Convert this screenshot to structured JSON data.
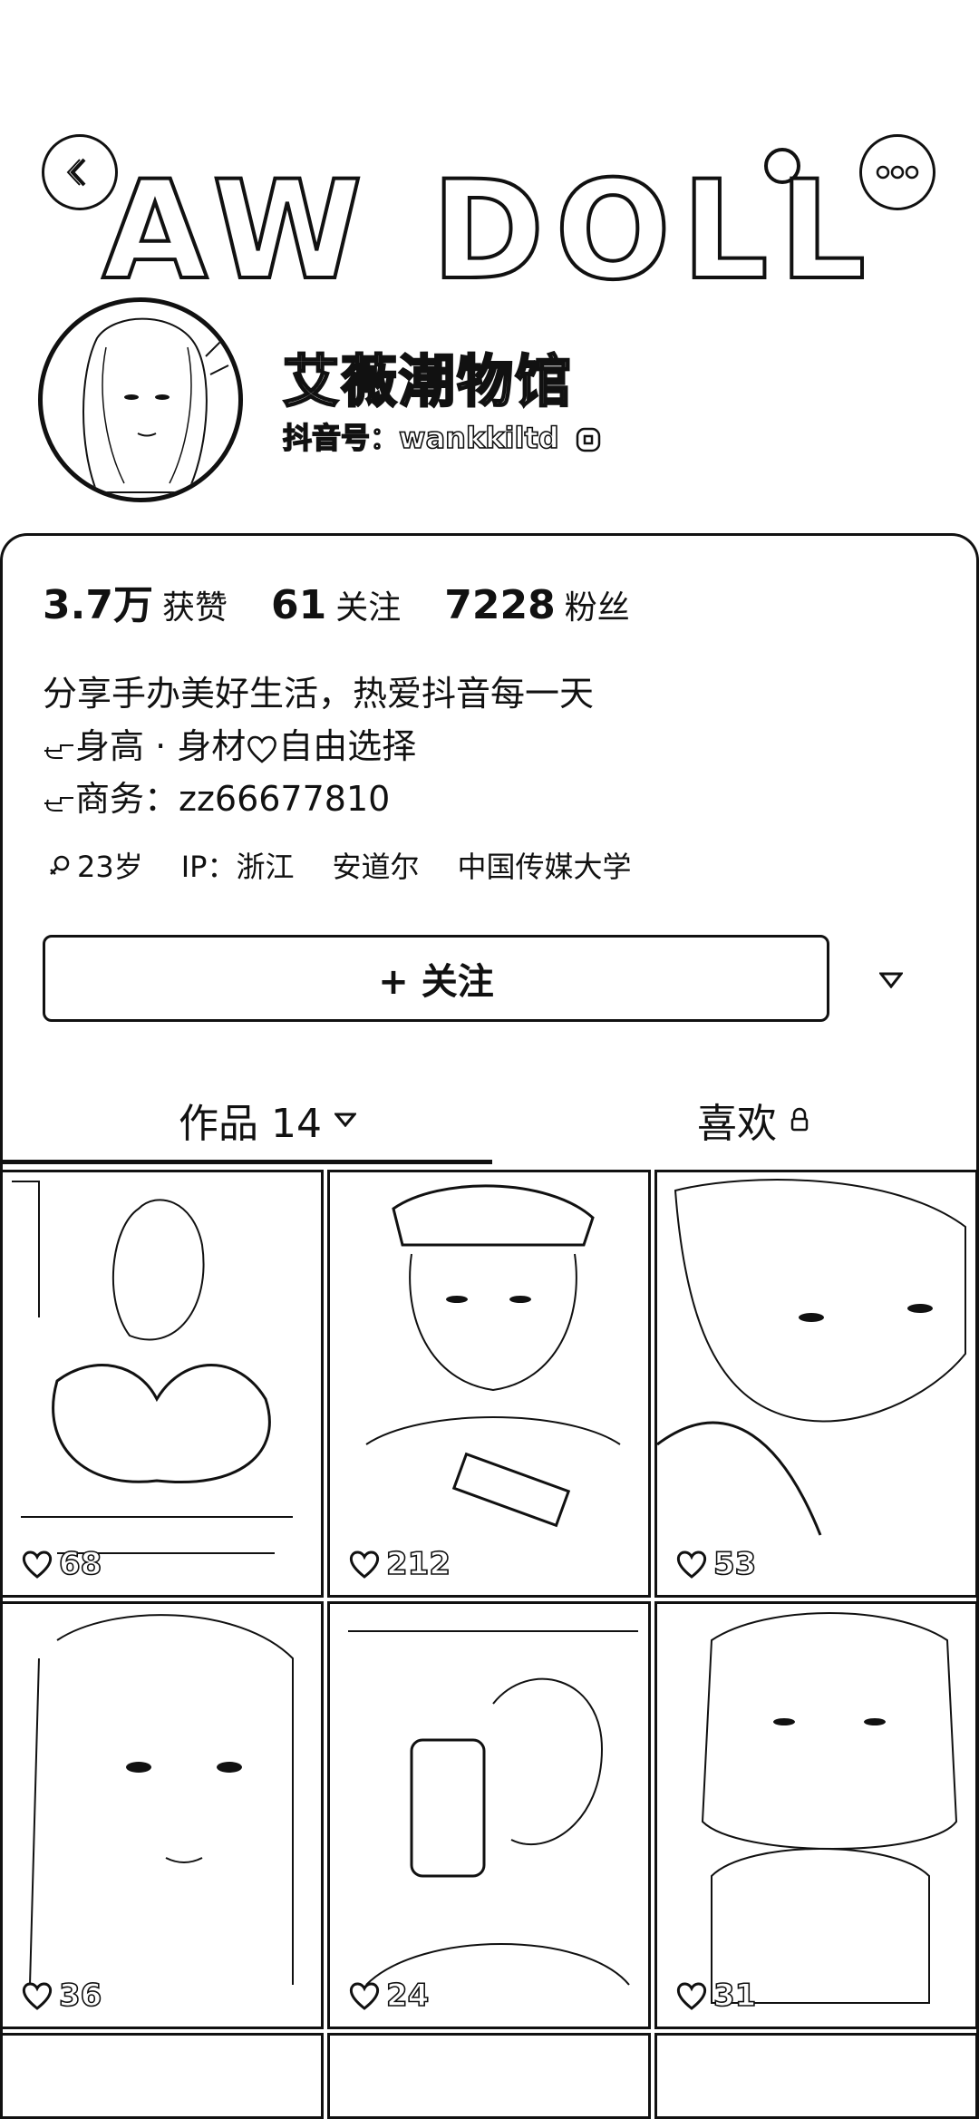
{
  "banner": {
    "title": "AW DOLL"
  },
  "nav": {
    "back_icon": "chevron-left-icon",
    "search_icon": "search-icon",
    "more_icon": "more-dots-icon"
  },
  "profile": {
    "nickname": "艾薇潮物馆",
    "douyin_id_label": "抖音号：",
    "douyin_id": "wankkiltd"
  },
  "stats": [
    {
      "num": "3.7万",
      "label": "获赞"
    },
    {
      "num": "61",
      "label": "关注"
    },
    {
      "num": "7228",
      "label": "粉丝"
    }
  ],
  "bio": {
    "line1": "分享手办美好生活，热爱抖音每一天",
    "line2_icon": "pointing-hand-icon",
    "line2": "身高 · 身材",
    "line2_heart": "heart-icon",
    "line2_tail": "自由选择",
    "line3_icon": "pointing-hand-icon",
    "line3": "商务：zz66677810"
  },
  "tags": {
    "age": "23岁",
    "ip": "IP：浙江",
    "place": "安道尔",
    "school": "中国传媒大学"
  },
  "actions": {
    "follow_label": "+ 关注"
  },
  "tabs": {
    "works_label": "作品 14",
    "likes_label": "喜欢"
  },
  "grid": [
    {
      "likes": "68"
    },
    {
      "likes": "212"
    },
    {
      "likes": "53"
    },
    {
      "likes": "36"
    },
    {
      "likes": "24"
    },
    {
      "likes": "31"
    }
  ]
}
